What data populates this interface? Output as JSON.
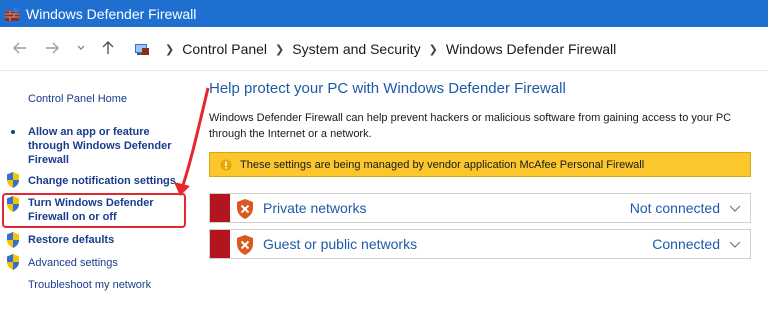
{
  "window": {
    "title": "Windows Defender Firewall",
    "app_icon": "firewall-brick-icon"
  },
  "nav": {
    "back_icon": "back-arrow-icon",
    "forward_icon": "forward-arrow-icon",
    "up_icon": "up-arrow-icon",
    "breadcrumbs": [
      "Control Panel",
      "System and Security",
      "Windows Defender Firewall"
    ]
  },
  "sidebar": {
    "home": "Control Panel Home",
    "items": [
      {
        "label": "Allow an app or feature through Windows Defender Firewall",
        "icon": "bullet"
      },
      {
        "label": "Change notification settings",
        "icon": "uac-shield-icon"
      },
      {
        "label": "Turn Windows Defender Firewall on or off",
        "icon": "uac-shield-icon",
        "highlighted": true
      },
      {
        "label": "Restore defaults",
        "icon": "uac-shield-icon"
      },
      {
        "label": "Advanced settings",
        "icon": "uac-shield-icon"
      },
      {
        "label": "Troubleshoot my network",
        "icon": "none"
      }
    ]
  },
  "main": {
    "title": "Help protect your PC with Windows Defender Firewall",
    "description": "Windows Defender Firewall can help prevent hackers or malicious software from gaining access to your PC through the Internet or a network.",
    "warning": "These settings are being managed by vendor application McAfee  Personal Firewall",
    "networks": [
      {
        "name": "Private networks",
        "status": "Not connected"
      },
      {
        "name": "Guest or public networks",
        "status": "Connected"
      }
    ]
  },
  "colors": {
    "titlebar": "#1f6fd1",
    "link": "#1a3c8c",
    "heading": "#1e5aa8",
    "warning_bg": "#fcc72d",
    "net_strip": "#b3151e",
    "annotation": "#e5262f"
  }
}
